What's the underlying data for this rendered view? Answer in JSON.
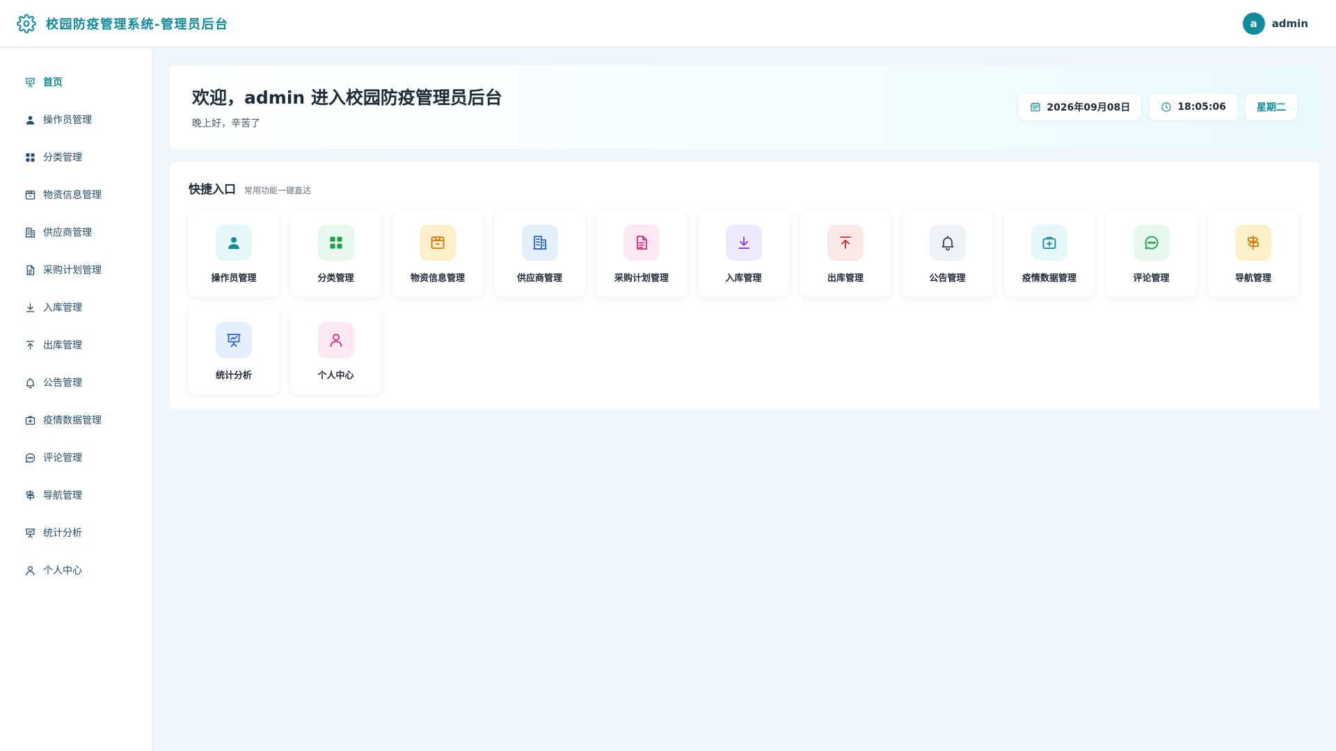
{
  "header": {
    "title": "校园防疫管理系统-管理员后台",
    "avatar_letter": "a",
    "username": "admin"
  },
  "sidebar": {
    "items": [
      {
        "label": "首页",
        "icon": "presentation-icon",
        "active": true
      },
      {
        "label": "操作员管理",
        "icon": "user-icon"
      },
      {
        "label": "分类管理",
        "icon": "grid-icon"
      },
      {
        "label": "物资信息管理",
        "icon": "box-icon"
      },
      {
        "label": "供应商管理",
        "icon": "building-icon"
      },
      {
        "label": "采购计划管理",
        "icon": "document-icon"
      },
      {
        "label": "入库管理",
        "icon": "download-icon"
      },
      {
        "label": "出库管理",
        "icon": "upload-icon"
      },
      {
        "label": "公告管理",
        "icon": "bell-icon"
      },
      {
        "label": "疫情数据管理",
        "icon": "medical-kit-icon"
      },
      {
        "label": "评论管理",
        "icon": "chat-icon"
      },
      {
        "label": "导航管理",
        "icon": "signpost-icon"
      },
      {
        "label": "统计分析",
        "icon": "presentation-icon"
      },
      {
        "label": "个人中心",
        "icon": "user-outline-icon"
      }
    ]
  },
  "welcome": {
    "title": "欢迎，admin 进入校园防疫管理员后台",
    "subtitle": "晚上好，辛苦了",
    "date": "2026年09月08日",
    "time": "18:05:06",
    "weekday": "星期二"
  },
  "quick": {
    "title": "快捷入口",
    "subtitle": "常用功能一键直达",
    "items": [
      {
        "label": "操作员管理",
        "icon": "user-icon",
        "bg": "#e6f7fa",
        "color": "#0e8c9c"
      },
      {
        "label": "分类管理",
        "icon": "grid-icon",
        "bg": "#e6f7ee",
        "color": "#16a34a"
      },
      {
        "label": "物资信息管理",
        "icon": "box-icon",
        "bg": "#fdefc9",
        "color": "#d97706"
      },
      {
        "label": "供应商管理",
        "icon": "building-icon",
        "bg": "#e3effb",
        "color": "#2563eb"
      },
      {
        "label": "采购计划管理",
        "icon": "document-icon",
        "bg": "#fce7f3",
        "color": "#db2777"
      },
      {
        "label": "入库管理",
        "icon": "download-icon",
        "bg": "#ede9fe",
        "color": "#7c3aed"
      },
      {
        "label": "出库管理",
        "icon": "upload-icon",
        "bg": "#fde8e8",
        "color": "#dc2626"
      },
      {
        "label": "公告管理",
        "icon": "bell-icon",
        "bg": "#eef1f5",
        "color": "#374151"
      },
      {
        "label": "疫情数据管理",
        "icon": "medical-kit-icon",
        "bg": "#e6f7fa",
        "color": "#0e8c9c"
      },
      {
        "label": "评论管理",
        "icon": "chat-icon",
        "bg": "#e6f7ee",
        "color": "#16a34a"
      },
      {
        "label": "导航管理",
        "icon": "signpost-icon",
        "bg": "#fdefc9",
        "color": "#d97706"
      },
      {
        "label": "统计分析",
        "icon": "presentation-icon",
        "bg": "#e3effb",
        "color": "#2563eb"
      },
      {
        "label": "个人中心",
        "icon": "user-outline-icon",
        "bg": "#fce7f3",
        "color": "#db2777"
      }
    ]
  },
  "colors": {
    "accent": "#0e8c9c",
    "page_bg": "#f1f6fb"
  }
}
